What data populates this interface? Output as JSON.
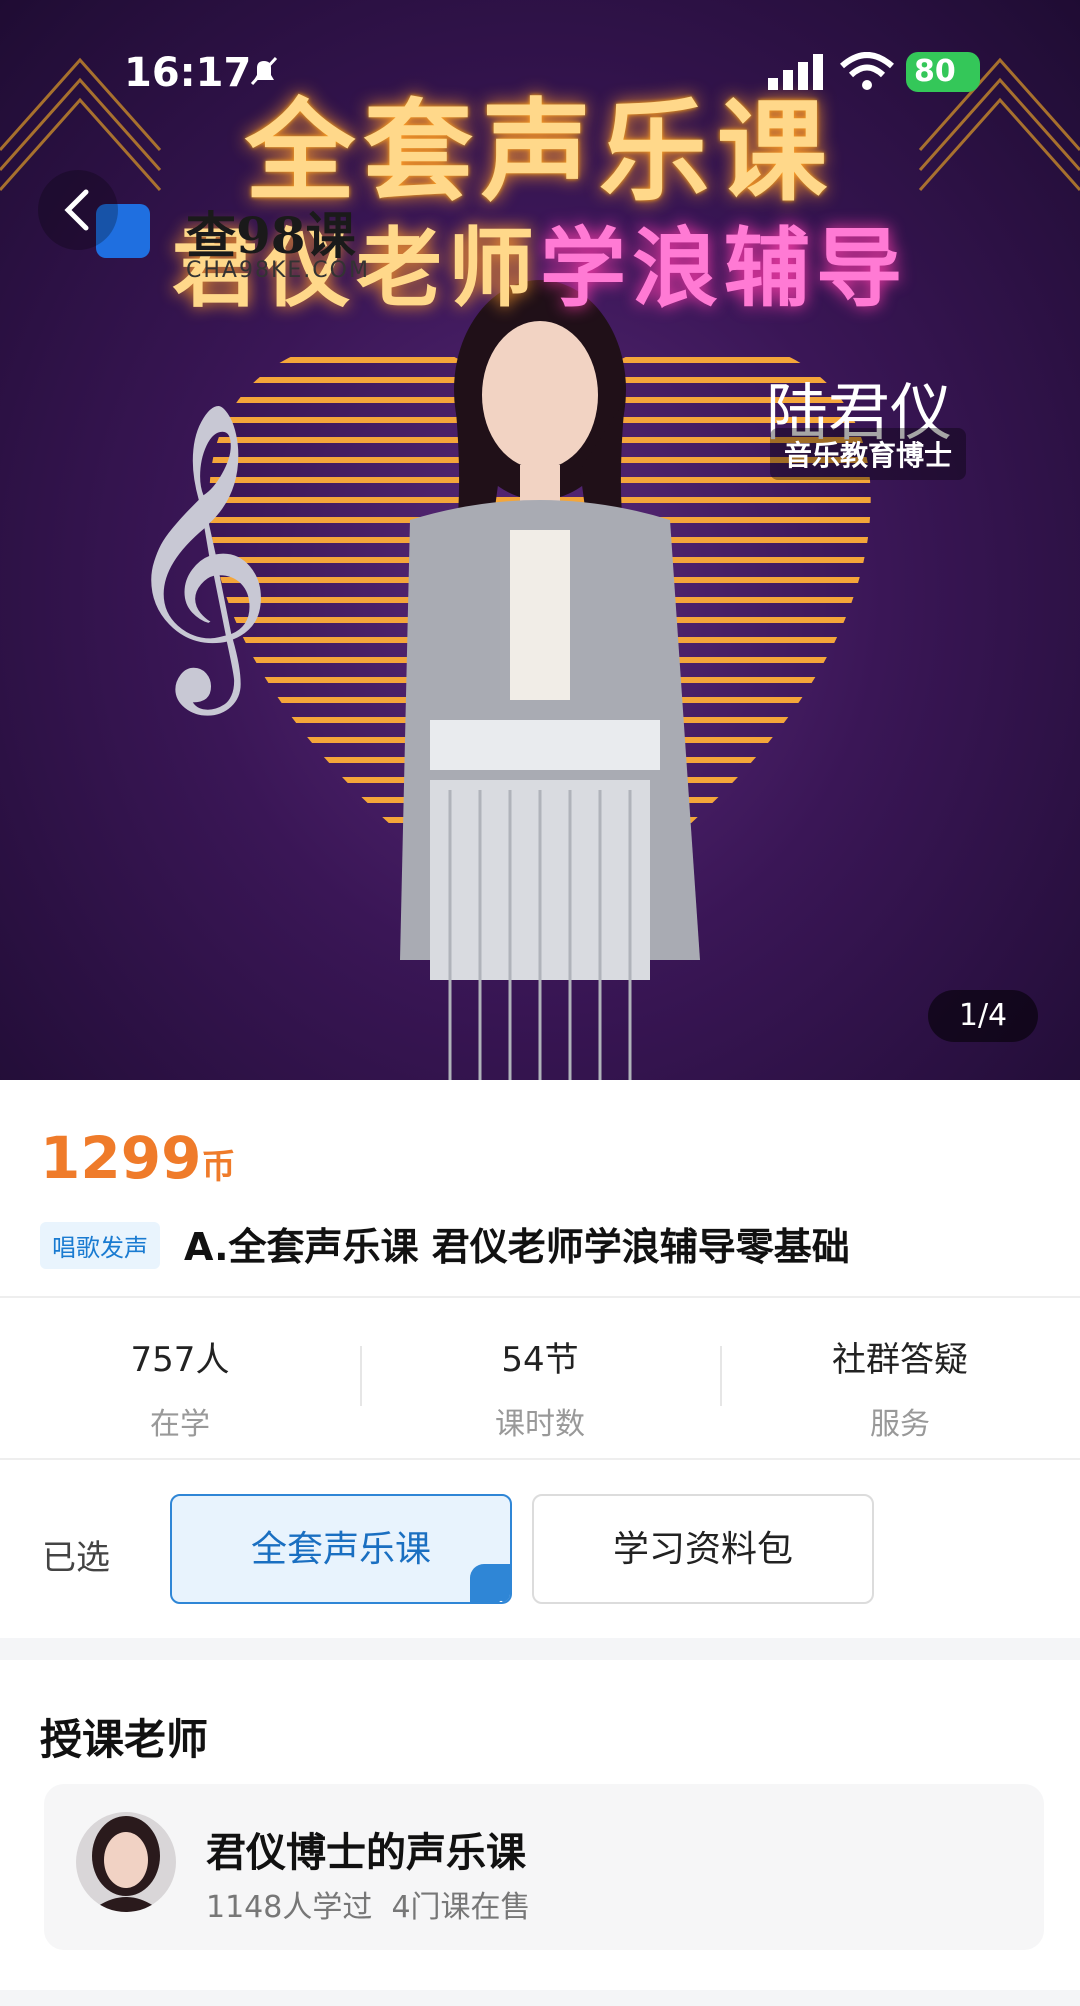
{
  "status_bar": {
    "time": "16:17",
    "battery": "80"
  },
  "hero": {
    "title": "全套声乐课",
    "subtitle_prefix": "君仪老师",
    "subtitle_highlight": "学浪辅导",
    "teacher_signature": "陆君仪",
    "teacher_role": "音乐教育博士",
    "watermark_text": "查98课",
    "watermark_sub": "CHA98KE.COM",
    "page_indicator": "1/4"
  },
  "course": {
    "price_value": "1299",
    "price_unit": "币",
    "category": "唱歌发声",
    "title": "A.全套声乐课 君仪老师学浪辅导零基础"
  },
  "stats": [
    {
      "value": "757人",
      "label": "在学"
    },
    {
      "value": "54节",
      "label": "课时数"
    },
    {
      "value": "社群答疑",
      "label": "服务"
    }
  ],
  "options": {
    "selected_label": "已选",
    "items": [
      {
        "label": "全套声乐课",
        "selected": true
      },
      {
        "label": "学习资料包",
        "selected": false
      }
    ]
  },
  "teacher_section": {
    "title": "授课老师",
    "name": "君仪博士的声乐课",
    "learners": "1148人学过",
    "courses": "4门课在售"
  },
  "colors": {
    "price": "#ef7b2a",
    "accent": "#2f86d6",
    "badge_text": "#1a7bd1"
  },
  "icons": [
    "bell-mute-icon",
    "signal-icon",
    "wifi-icon",
    "battery-icon",
    "back-arrow-icon",
    "treble-clef-icon",
    "check-icon"
  ]
}
